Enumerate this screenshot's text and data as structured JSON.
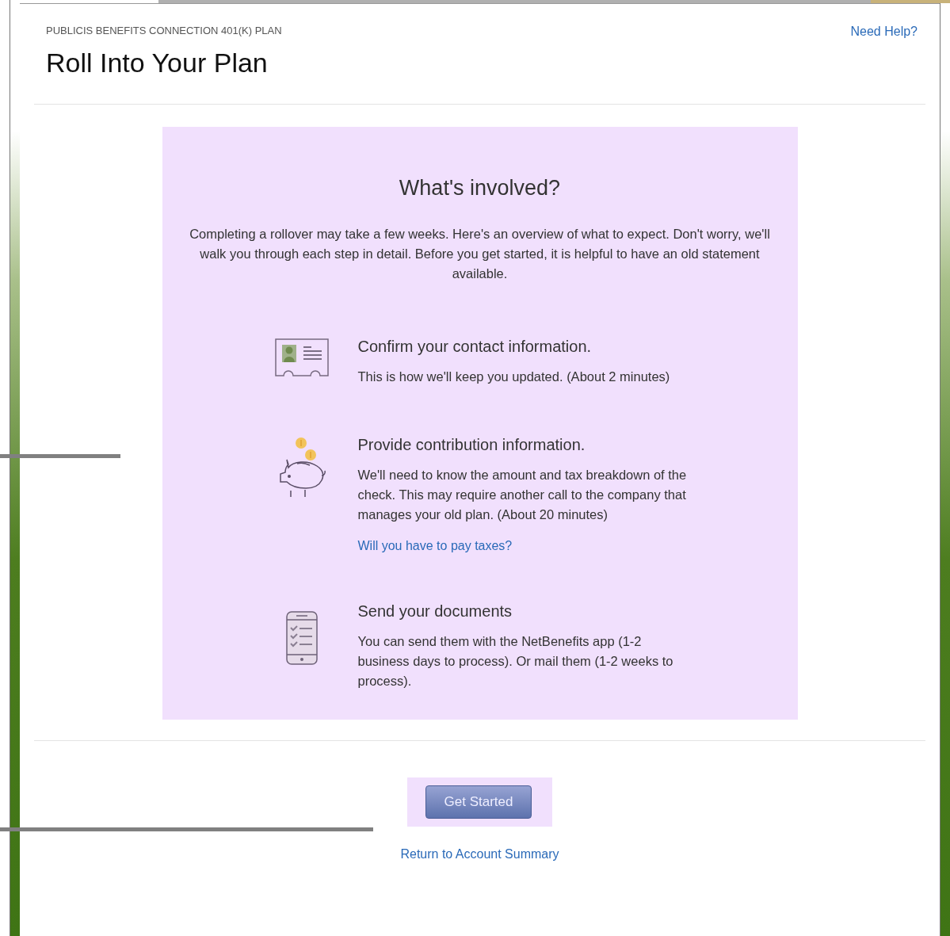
{
  "header": {
    "plan_name": "PUBLICIS BENEFITS CONNECTION 401(K) PLAN",
    "title": "Roll Into Your Plan",
    "help_link": "Need Help?"
  },
  "overview": {
    "heading": "What's involved?",
    "intro": "Completing a rollover may take a few weeks. Here's an overview of what to expect. Don't worry, we'll walk you through each step in detail. Before you get started, it is helpful to have an old statement available.",
    "steps": [
      {
        "kind": "contact-card",
        "title": "Confirm your contact information.",
        "description": "This is how we'll keep you updated. (About 2 minutes)"
      },
      {
        "kind": "piggy-bank",
        "title": "Provide contribution information.",
        "description": "We'll need to know the amount and tax breakdown of the check. This may require another call to the company that manages your old plan. (About 20 minutes)",
        "link": "Will you have to pay taxes?"
      },
      {
        "kind": "phone-checklist",
        "title": "Send your documents",
        "description": "You can send them with the NetBenefits app (1-2 business days to process). Or mail them (1-2 weeks to process)."
      }
    ]
  },
  "actions": {
    "primary_button": "Get Started",
    "return_link": "Return to Account Summary"
  }
}
